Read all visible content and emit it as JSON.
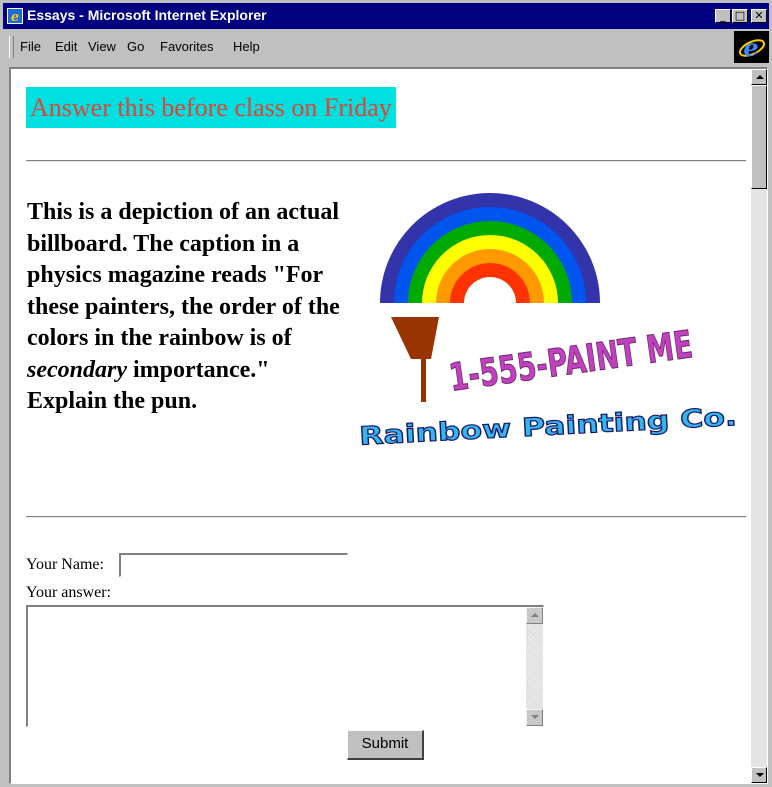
{
  "window": {
    "title": "Essays - Microsoft Internet Explorer",
    "minimize_glyph": "_",
    "maximize_glyph": "□",
    "close_glyph": "✕"
  },
  "menu": {
    "items": [
      {
        "label": "File"
      },
      {
        "label": "Edit"
      },
      {
        "label": "View"
      },
      {
        "label": "Go"
      },
      {
        "label": "Favorites"
      },
      {
        "label": "Help"
      }
    ]
  },
  "page": {
    "heading": "Answer this before class on Friday",
    "heading_bg": "#00e0e0",
    "heading_color": "#e34234",
    "question_part1": "This is a depiction of an actual billboard. The caption in a physics magazine reads \"For these painters, the order of the colors in the rainbow is of ",
    "question_emphasis": "secondary",
    "question_part2": " importance.\"",
    "question_part3": "Explain the pun."
  },
  "billboard": {
    "phone_text": "1-555-PAINT ME",
    "company_text": "Rainbow Painting Co.",
    "rainbow_colors": [
      "#3333aa",
      "#0055ee",
      "#00aa00",
      "#ffff00",
      "#ff9900",
      "#ff3300"
    ]
  },
  "form": {
    "name_label": "Your Name:",
    "name_value": "",
    "answer_label": "Your answer:",
    "answer_value": "",
    "submit_label": "Submit"
  }
}
